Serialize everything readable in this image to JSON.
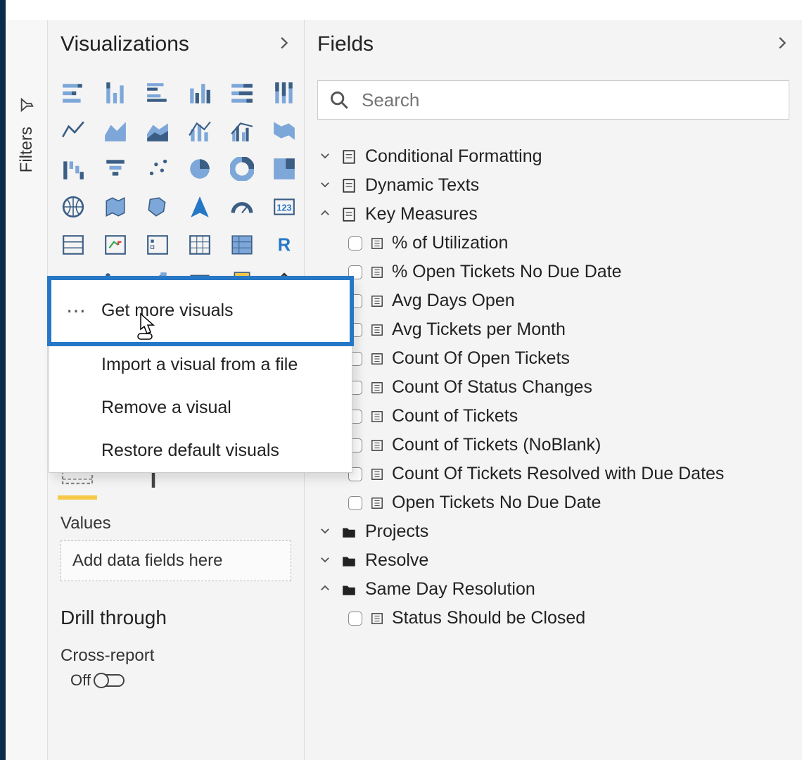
{
  "filters_rail": {
    "label": "Filters"
  },
  "visualizations": {
    "title": "Visualizations",
    "values_label": "Values",
    "values_placeholder": "Add data fields here",
    "drill_title": "Drill through",
    "cross_report_label": "Cross-report",
    "cross_report_value": "Off"
  },
  "context_menu": {
    "get_more": "Get more visuals",
    "import_file": "Import a visual from a file",
    "remove": "Remove a visual",
    "restore": "Restore default visuals"
  },
  "fields": {
    "title": "Fields",
    "search_placeholder": "Search",
    "tables": [
      {
        "name": "Conditional Formatting",
        "expanded": false,
        "type": "measure-group"
      },
      {
        "name": "Dynamic Texts",
        "expanded": false,
        "type": "measure-group"
      },
      {
        "name": "Key Measures",
        "expanded": true,
        "type": "measure-group",
        "children": [
          "% of Utilization",
          "% Open Tickets No Due Date",
          "Avg Days Open",
          "Avg Tickets per Month",
          "Count Of Open Tickets",
          "Count Of Status Changes",
          "Count of Tickets",
          "Count of Tickets (NoBlank)",
          "Count Of Tickets Resolved with Due Dates",
          "Open Tickets No Due Date"
        ]
      },
      {
        "name": "Projects",
        "expanded": false,
        "type": "table"
      },
      {
        "name": "Resolve",
        "expanded": false,
        "type": "table"
      },
      {
        "name": "Same Day Resolution",
        "expanded": true,
        "type": "table",
        "children": [
          "Status Should be Closed"
        ]
      }
    ]
  }
}
